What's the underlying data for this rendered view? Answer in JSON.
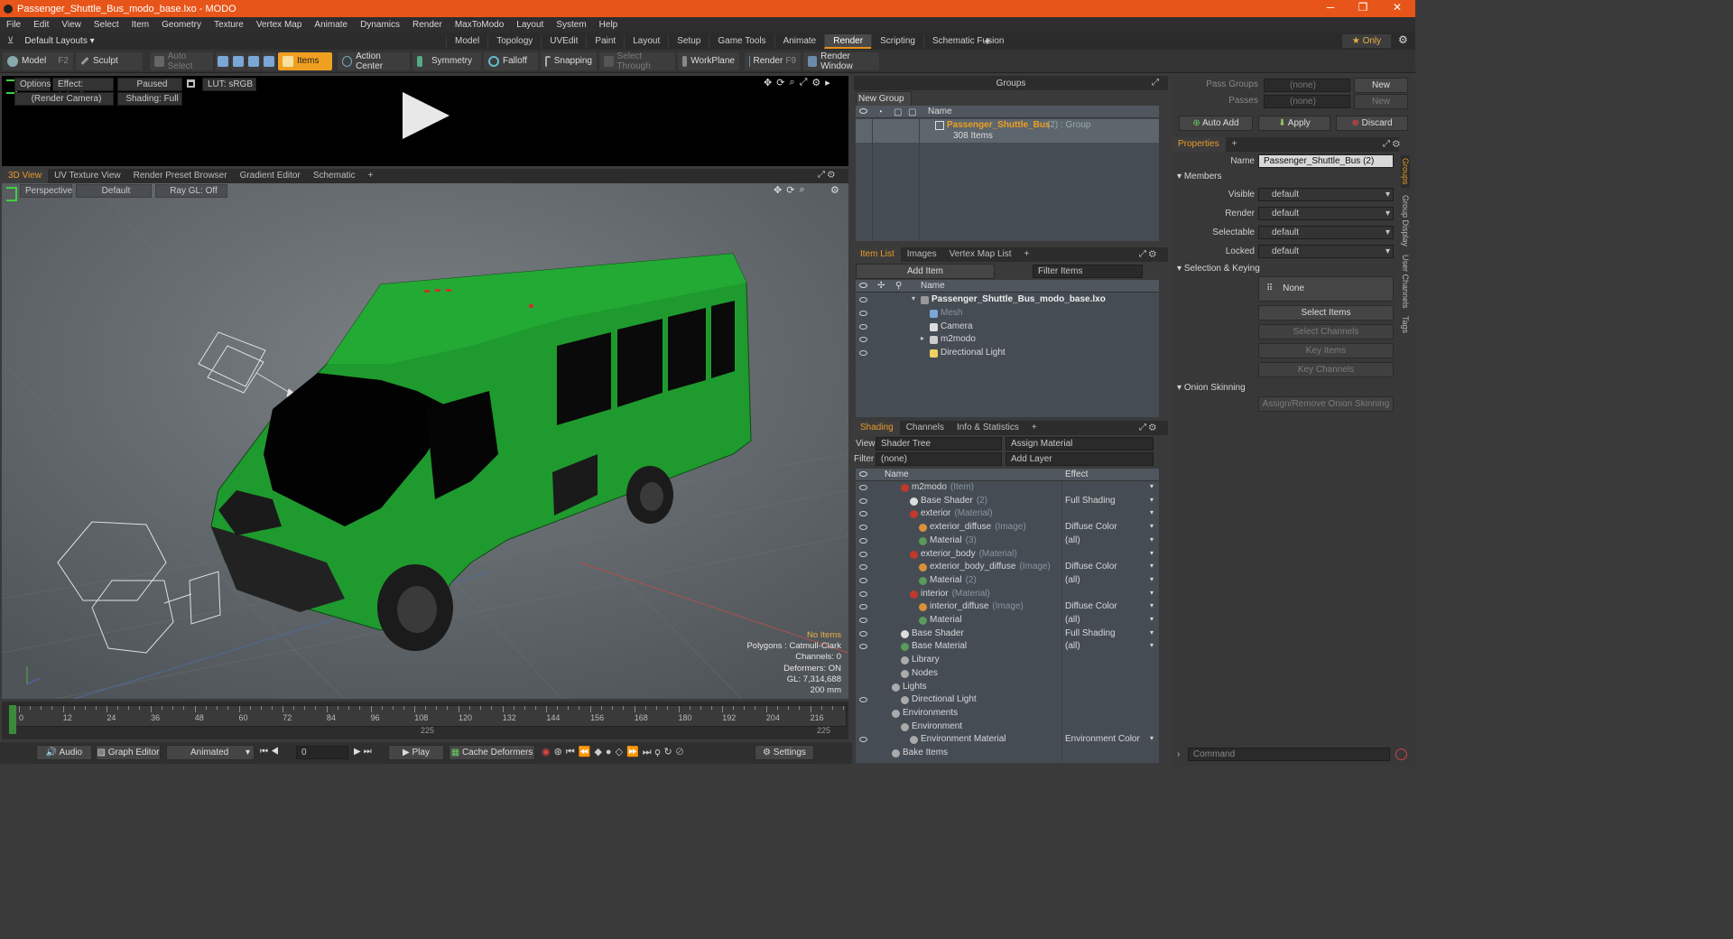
{
  "window": {
    "title": "Passenger_Shuttle_Bus_modo_base.lxo - MODO",
    "controls": [
      "─",
      "❐",
      "✕"
    ]
  },
  "menu": [
    "File",
    "Edit",
    "View",
    "Select",
    "Item",
    "Geometry",
    "Texture",
    "Vertex Map",
    "Animate",
    "Dynamics",
    "Render",
    "MaxToModo",
    "Layout",
    "System",
    "Help"
  ],
  "layout": {
    "selector": "Default Layouts ▾",
    "tabs": [
      "Model",
      "Topology",
      "UVEdit",
      "Paint",
      "Layout",
      "Setup",
      "Game Tools",
      "Animate",
      "Render",
      "Scripting",
      "Schematic Fusion"
    ],
    "active": "Render",
    "add": "+",
    "only": "★ Only"
  },
  "toolbar": {
    "model": "Model",
    "model_key": "F2",
    "sculpt": "Sculpt",
    "auto_select": "Auto Select",
    "items": "Items",
    "action_center": "Action Center",
    "symmetry": "Symmetry",
    "falloff": "Falloff",
    "snapping": "Snapping",
    "select_through": "Select Through",
    "workplane": "WorkPlane",
    "render": "Render",
    "render_key": "F9",
    "render_window": "Render Window"
  },
  "preview": {
    "options": "Options",
    "effect": "Effect: (Shadi...",
    "paused": "Paused",
    "lut": "LUT: sRGB",
    "camera": "(Render Camera)",
    "shading": "Shading: Full"
  },
  "viewtabs": [
    "3D View",
    "UV Texture View",
    "Render Preset Browser",
    "Gradient Editor",
    "Schematic",
    "+"
  ],
  "viewport": {
    "perspective": "Perspective",
    "default": "Default",
    "raygl": "Ray GL: Off",
    "stats": {
      "no_items": "No Items",
      "polygons": "Polygons : Catmull-Clark",
      "channels": "Channels: 0",
      "deformers": "Deformers: ON",
      "gl": "GL: 7,314,688",
      "size": "200 mm"
    }
  },
  "timeline": {
    "ticks": [
      "0",
      "12",
      "24",
      "36",
      "48",
      "60",
      "72",
      "84",
      "96",
      "108",
      "120",
      "132",
      "144",
      "156",
      "168",
      "180",
      "192",
      "204",
      "216"
    ],
    "sub_mid": "225",
    "sub_end": "225"
  },
  "bottombar": {
    "audio": "Audio",
    "graph_editor": "Graph Editor",
    "animated": "Animated",
    "frame": "0",
    "play": "Play",
    "cache_deformers": "Cache Deformers",
    "settings": "Settings"
  },
  "groups": {
    "title": "Groups",
    "new_group": "New Group",
    "col_name": "Name",
    "item_name": "Passenger_Shuttle_Bus",
    "item_count": "(2)",
    "item_type": ": Group",
    "item_sub": "308 Items"
  },
  "itemlist": {
    "tabs": [
      "Item List",
      "Images",
      "Vertex Map List",
      "+"
    ],
    "add_item": "Add Item",
    "filter": "Filter Items",
    "col_name": "Name",
    "rows": [
      {
        "name": "Passenger_Shuttle_Bus_modo_base.lxo",
        "indent": 0,
        "bold": true
      },
      {
        "name": "Mesh",
        "indent": 1,
        "dim": true
      },
      {
        "name": "Camera",
        "indent": 1
      },
      {
        "name": "m2modo",
        "indent": 1
      },
      {
        "name": "Directional Light",
        "indent": 1
      }
    ]
  },
  "shading": {
    "tabs": [
      "Shading",
      "Channels",
      "Info & Statistics",
      "+"
    ],
    "view_label": "View",
    "view_value": "Shader Tree",
    "assign": "Assign Material",
    "filter_label": "Filter",
    "filter_value": "(none)",
    "add_layer": "Add Layer",
    "col_name": "Name",
    "col_effect": "Effect",
    "rows": [
      {
        "name": "m2modo",
        "tag": "(Item)",
        "effect": "",
        "indent": 1
      },
      {
        "name": "Base Shader",
        "tag": "(2)",
        "effect": "Full Shading",
        "indent": 2
      },
      {
        "name": "exterior",
        "tag": "(Material)",
        "effect": "",
        "indent": 2
      },
      {
        "name": "exterior_diffuse",
        "tag": "(Image)",
        "effect": "Diffuse Color",
        "indent": 3
      },
      {
        "name": "Material",
        "tag": "(3)",
        "effect": "(all)",
        "indent": 3
      },
      {
        "name": "exterior_body",
        "tag": "(Material)",
        "effect": "",
        "indent": 2
      },
      {
        "name": "exterior_body_diffuse",
        "tag": "(Image)",
        "effect": "Diffuse Color",
        "indent": 3
      },
      {
        "name": "Material",
        "tag": "(2)",
        "effect": "(all)",
        "indent": 3
      },
      {
        "name": "interior",
        "tag": "(Material)",
        "effect": "",
        "indent": 2
      },
      {
        "name": "interior_diffuse",
        "tag": "(Image)",
        "effect": "Diffuse Color",
        "indent": 3
      },
      {
        "name": "Material",
        "tag": "",
        "effect": "(all)",
        "indent": 3
      },
      {
        "name": "Base Shader",
        "tag": "",
        "effect": "Full Shading",
        "indent": 1
      },
      {
        "name": "Base Material",
        "tag": "",
        "effect": "(all)",
        "indent": 1
      },
      {
        "name": "Library",
        "tag": "",
        "effect": "",
        "indent": 1
      },
      {
        "name": "Nodes",
        "tag": "",
        "effect": "",
        "indent": 1
      },
      {
        "name": "Lights",
        "tag": "",
        "effect": "",
        "indent": 0
      },
      {
        "name": "Directional Light",
        "tag": "",
        "effect": "",
        "indent": 1
      },
      {
        "name": "Environments",
        "tag": "",
        "effect": "",
        "indent": 0
      },
      {
        "name": "Environment",
        "tag": "",
        "effect": "",
        "indent": 1
      },
      {
        "name": "Environment Material",
        "tag": "",
        "effect": "Environment Color",
        "indent": 2
      },
      {
        "name": "Bake Items",
        "tag": "",
        "effect": "",
        "indent": 0
      }
    ]
  },
  "properties": {
    "pass_groups_label": "Pass Groups",
    "pass_groups_value": "(none)",
    "passes_label": "Passes",
    "passes_value": "(none)",
    "new": "New",
    "auto_add": "Auto Add",
    "apply": "Apply",
    "discard": "Discard",
    "tab": "Properties",
    "name_label": "Name",
    "name_value": "Passenger_Shuttle_Bus (2)",
    "members": "Members",
    "visible_label": "Visible",
    "render_label": "Render",
    "selectable_label": "Selectable",
    "locked_label": "Locked",
    "default": "default",
    "selection_keying": "Selection & Keying",
    "none": "None",
    "select_items": "Select Items",
    "select_channels": "Select Channels",
    "key_items": "Key Items",
    "key_channels": "Key Channels",
    "onion_skinning": "Onion Skinning",
    "assign_onion": "Assign/Remove Onion Skinning",
    "side_tabs": [
      "Groups",
      "Group Display",
      "User Channels",
      "Tags"
    ],
    "command": "Command"
  }
}
